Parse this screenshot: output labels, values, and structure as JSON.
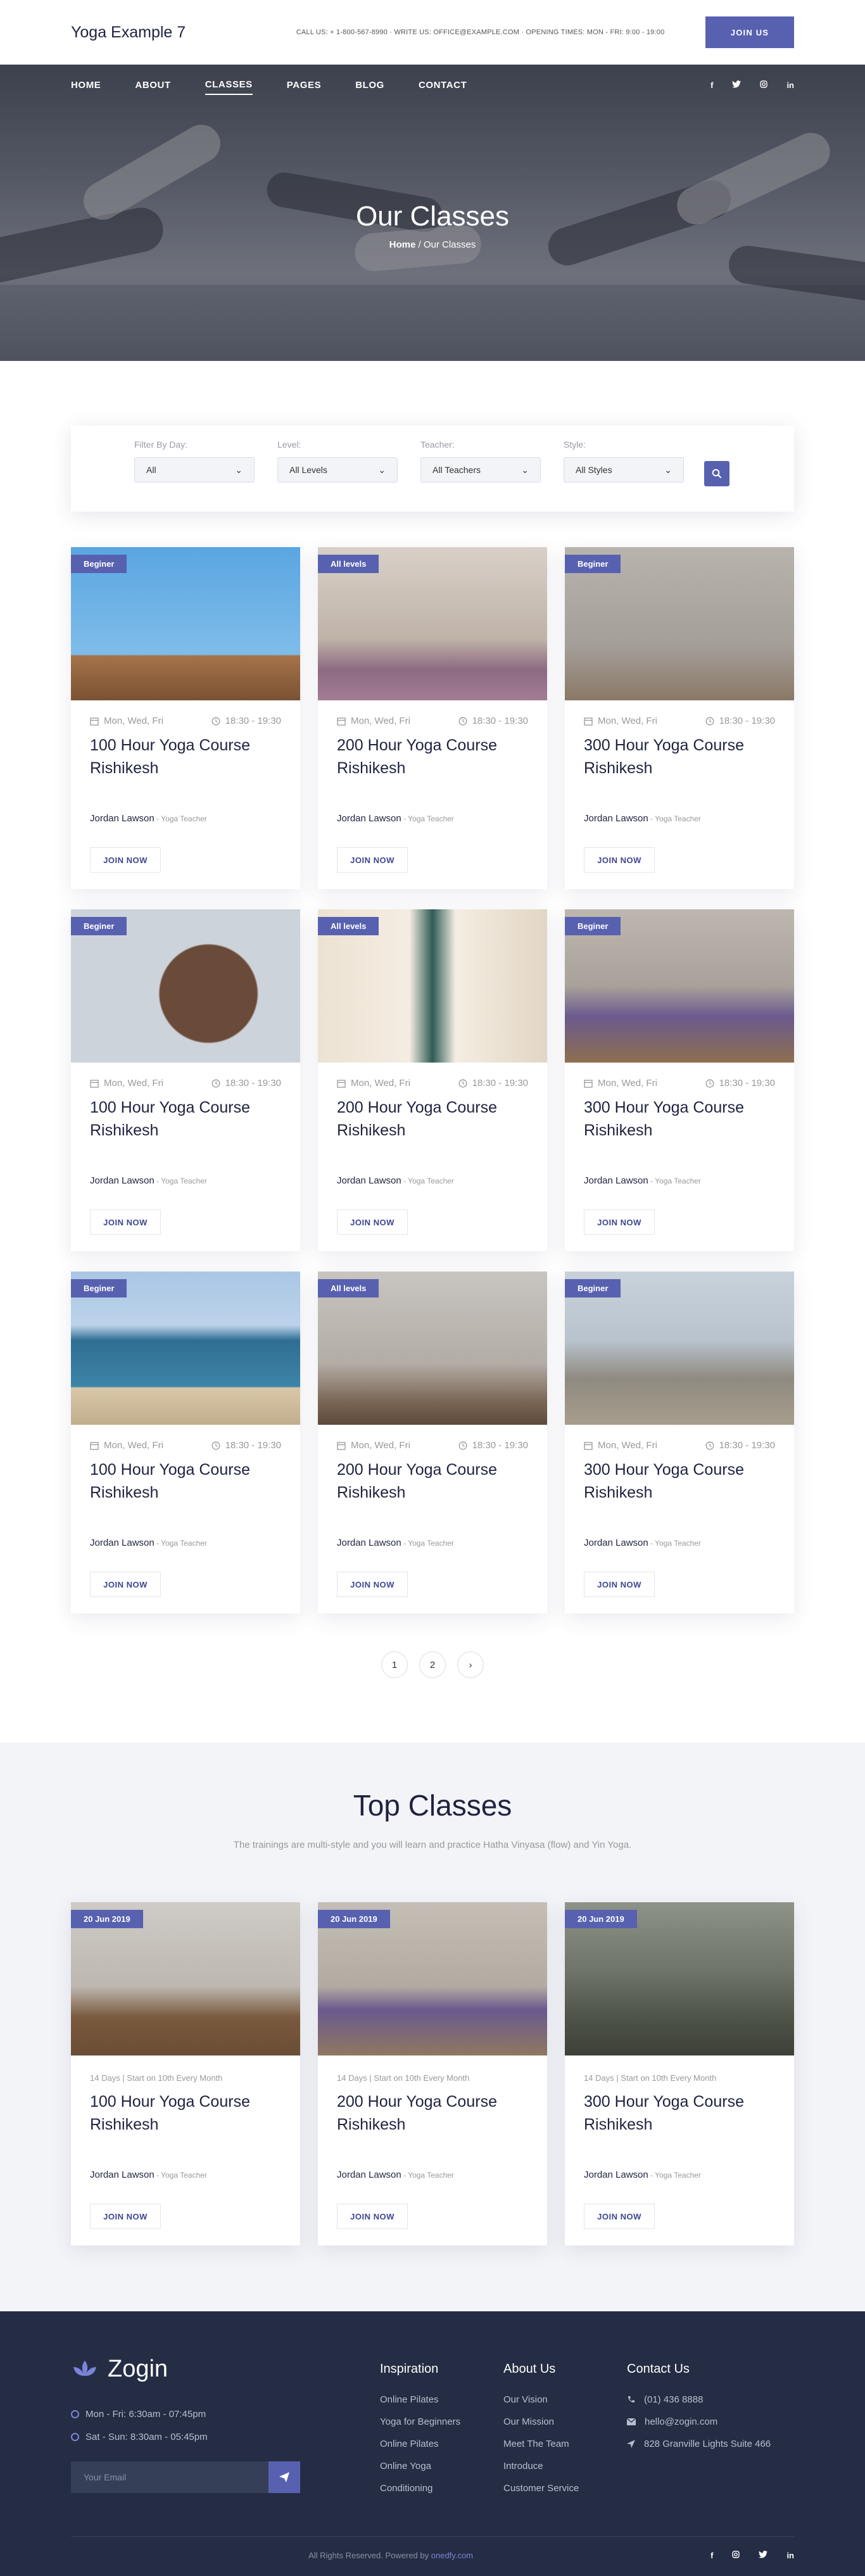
{
  "header": {
    "brand": "Yoga Example 7",
    "contact": "CALL US: + 1-800-567-8990 · WRITE US: OFFICE@EXAMPLE.COM · OPENING TIMES: MON - FRI: 9:00 - 19:00",
    "join_label": "JOIN US"
  },
  "nav": {
    "items": [
      "HOME",
      "ABOUT",
      "CLASSES",
      "PAGES",
      "BLOG",
      "CONTACT"
    ],
    "active": "CLASSES",
    "social": [
      "f",
      "t",
      "ig",
      "in"
    ]
  },
  "hero": {
    "title": "Our Classes",
    "crumb_home": "Home",
    "crumb_sep": "/",
    "crumb_current": "Our Classes"
  },
  "filter": {
    "day": {
      "label": "Filter By Day:",
      "value": "All"
    },
    "level": {
      "label": "Level:",
      "value": "All Levels"
    },
    "teacher": {
      "label": "Teacher:",
      "value": "All Teachers"
    },
    "style": {
      "label": "Style:",
      "value": "All Styles"
    }
  },
  "classes": [
    {
      "badge": "Beginer",
      "days": "Mon, Wed, Fri",
      "time": "18:30 - 19:30",
      "title": "100 Hour Yoga Course Rishikesh",
      "teacher": "Jordan Lawson",
      "role": " - Yoga Teacher",
      "button": "JOIN NOW"
    },
    {
      "badge": "All levels",
      "days": "Mon, Wed, Fri",
      "time": "18:30 - 19:30",
      "title": "200 Hour Yoga Course Rishikesh",
      "teacher": "Jordan Lawson",
      "role": " - Yoga Teacher",
      "button": "JOIN NOW"
    },
    {
      "badge": "Beginer",
      "days": "Mon, Wed, Fri",
      "time": "18:30 - 19:30",
      "title": "300 Hour Yoga Course Rishikesh",
      "teacher": "Jordan Lawson",
      "role": " - Yoga Teacher",
      "button": "JOIN NOW"
    },
    {
      "badge": "Beginer",
      "days": "Mon, Wed, Fri",
      "time": "18:30 - 19:30",
      "title": "100 Hour Yoga Course Rishikesh",
      "teacher": "Jordan Lawson",
      "role": " - Yoga Teacher",
      "button": "JOIN NOW"
    },
    {
      "badge": "All levels",
      "days": "Mon, Wed, Fri",
      "time": "18:30 - 19:30",
      "title": "200 Hour Yoga Course Rishikesh",
      "teacher": "Jordan Lawson",
      "role": " - Yoga Teacher",
      "button": "JOIN NOW"
    },
    {
      "badge": "Beginer",
      "days": "Mon, Wed, Fri",
      "time": "18:30 - 19:30",
      "title": "300 Hour Yoga Course Rishikesh",
      "teacher": "Jordan Lawson",
      "role": " - Yoga Teacher",
      "button": "JOIN NOW"
    },
    {
      "badge": "Beginer",
      "days": "Mon, Wed, Fri",
      "time": "18:30 - 19:30",
      "title": "100 Hour Yoga Course Rishikesh",
      "teacher": "Jordan Lawson",
      "role": " - Yoga Teacher",
      "button": "JOIN NOW"
    },
    {
      "badge": "All levels",
      "days": "Mon, Wed, Fri",
      "time": "18:30 - 19:30",
      "title": "200 Hour Yoga Course Rishikesh",
      "teacher": "Jordan Lawson",
      "role": " - Yoga Teacher",
      "button": "JOIN NOW"
    },
    {
      "badge": "Beginer",
      "days": "Mon, Wed, Fri",
      "time": "18:30 - 19:30",
      "title": "300 Hour Yoga Course Rishikesh",
      "teacher": "Jordan Lawson",
      "role": " - Yoga Teacher",
      "button": "JOIN NOW"
    }
  ],
  "pagination": [
    "1",
    "2",
    "›"
  ],
  "top_classes": {
    "title": "Top Classes",
    "description": "The trainings are multi-style and you will learn and practice Hatha Vinyasa (flow) and Yin Yoga.",
    "items": [
      {
        "badge": "20 Jun 2019",
        "sub": "14 Days | Start on 10th Every Month",
        "title": "100 Hour Yoga Course Rishikesh",
        "teacher": "Jordan Lawson",
        "role": " - Yoga Teacher",
        "button": "JOIN NOW"
      },
      {
        "badge": "20 Jun 2019",
        "sub": "14 Days | Start on 10th Every Month",
        "title": "200 Hour Yoga Course Rishikesh",
        "teacher": "Jordan Lawson",
        "role": " - Yoga Teacher",
        "button": "JOIN NOW"
      },
      {
        "badge": "20 Jun 2019",
        "sub": "14 Days | Start on 10th Every Month",
        "title": "300 Hour Yoga Course Rishikesh",
        "teacher": "Jordan Lawson",
        "role": " - Yoga Teacher",
        "button": "JOIN NOW"
      }
    ]
  },
  "footer": {
    "brand": "Zogin",
    "hours": [
      "Mon - Fri: 6:30am - 07:45pm",
      "Sat - Sun: 8:30am - 05:45pm"
    ],
    "email_placeholder": "Your Email",
    "inspiration": {
      "title": "Inspiration",
      "links": [
        "Online Pilates",
        "Yoga for Beginners",
        "Online Pilates",
        "Online Yoga",
        "Conditioning"
      ]
    },
    "about": {
      "title": "About Us",
      "links": [
        "Our Vision",
        "Our Mission",
        "Meet The Team",
        "Introduce",
        "Customer Service"
      ]
    },
    "contact": {
      "title": "Contact Us",
      "phone": "(01) 436 8888",
      "email": "hello@zogin.com",
      "address": "828 Granville Lights Suite 466"
    },
    "copyright": "All Rights Reserved. Powered by ",
    "copyright_link": "onedfy.com",
    "social": [
      "f",
      "ig",
      "t",
      "in"
    ]
  },
  "colors": {
    "accent": "#5861b0",
    "footer_bg": "#252d44",
    "section_bg": "#f3f4f8"
  }
}
